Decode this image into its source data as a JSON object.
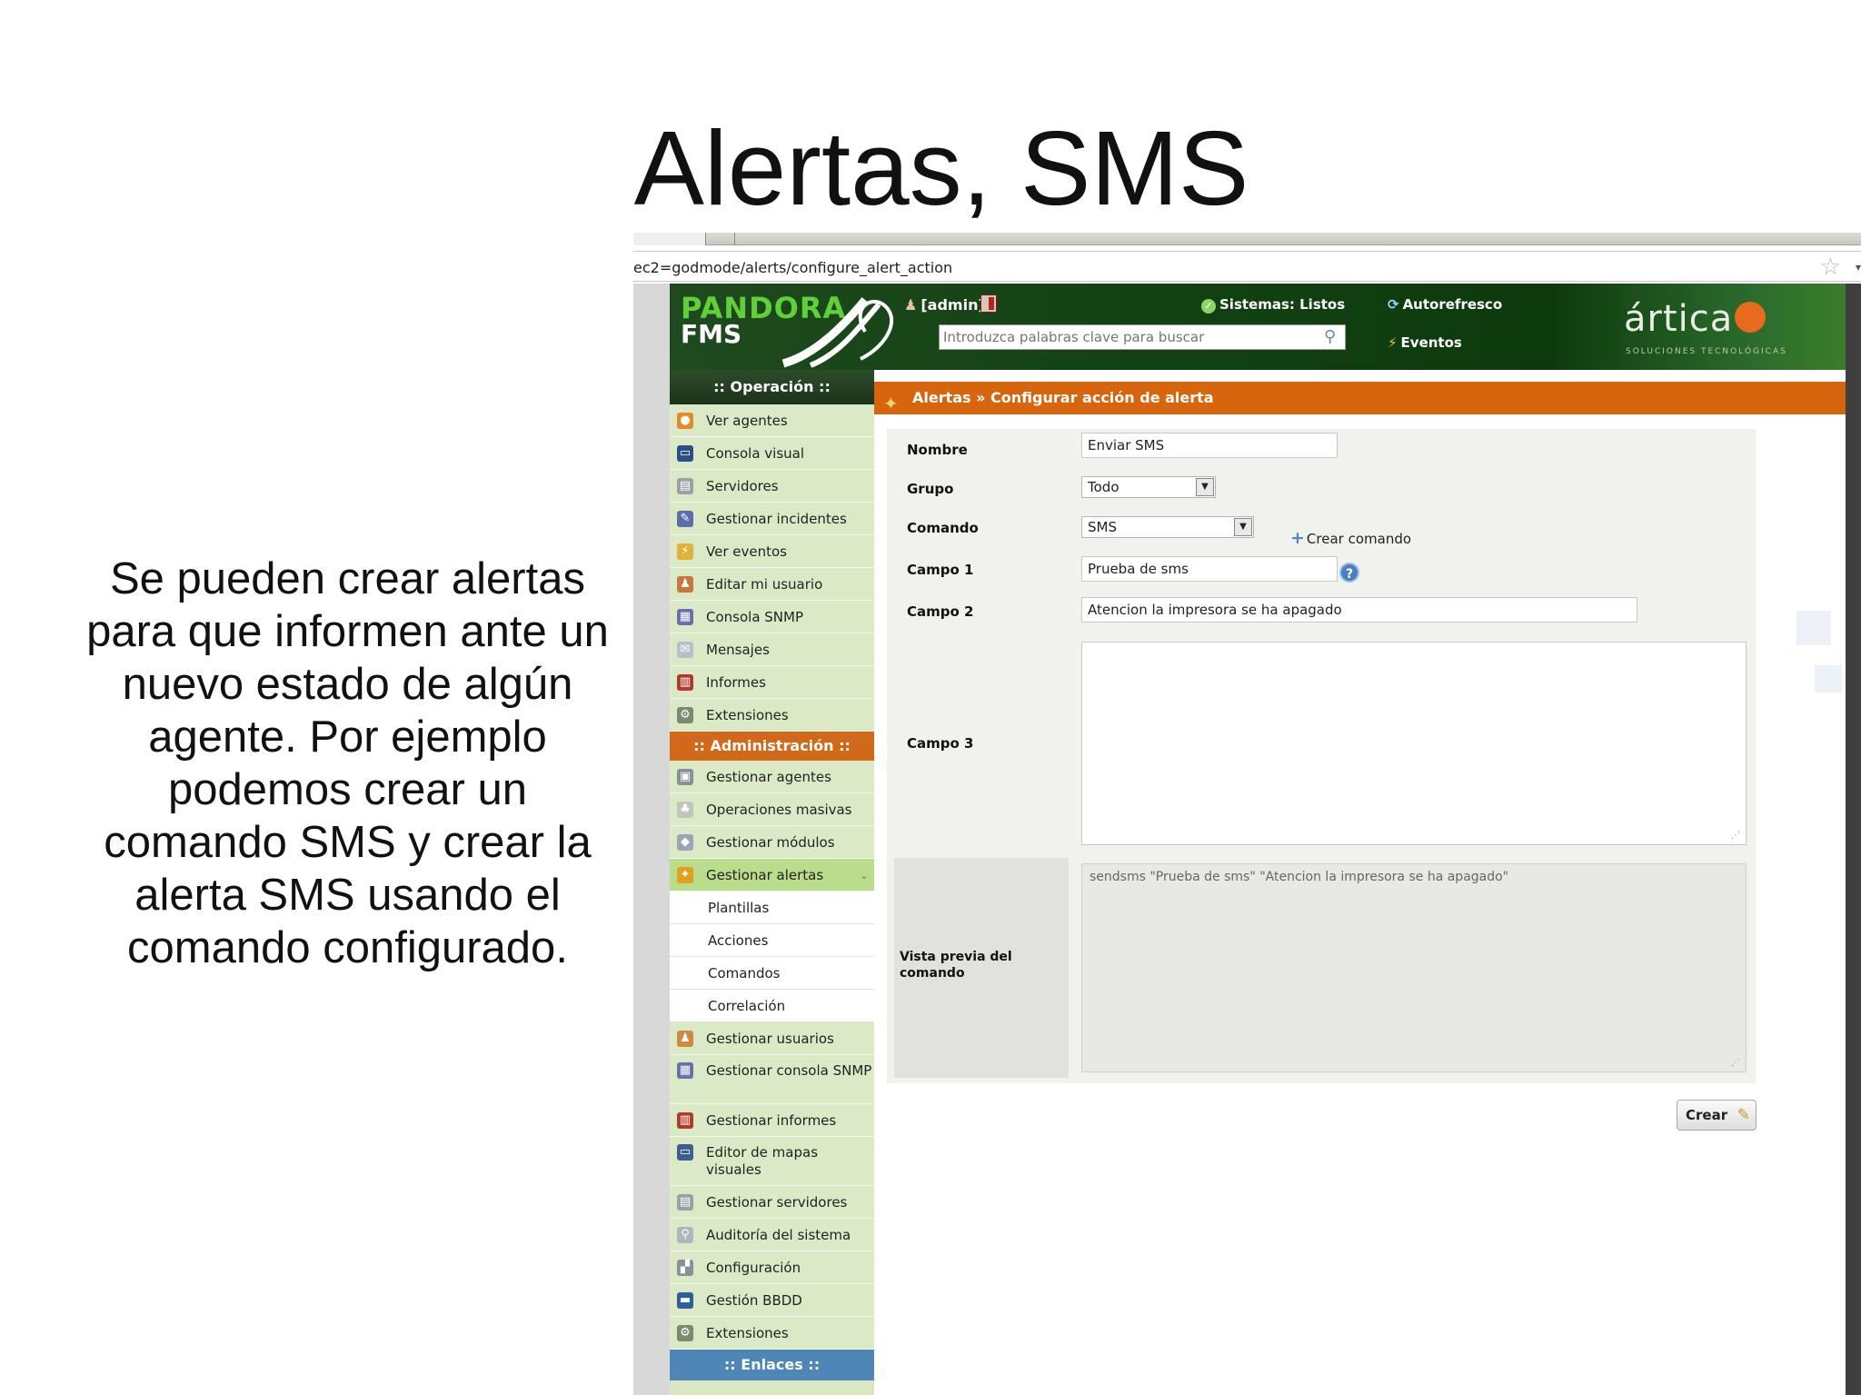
{
  "slide": {
    "title": "Alertas, SMS",
    "body": "Se pueden crear alertas para que informen ante un nuevo estado de algún agente. Por ejemplo podemos crear un comando SMS y crear la alerta SMS usando el comando configurado."
  },
  "browser": {
    "url": "ec2=godmode/alerts/configure_alert_action"
  },
  "header": {
    "logo_top": "PANDORA",
    "logo_bottom": "FMS",
    "user": "[admin]",
    "status": "Sistemas: Listos",
    "search_placeholder": "Introduzca palabras clave para buscar",
    "autorefresh": "Autorefresco",
    "events": "Eventos",
    "brand": "ártica",
    "brand_sub": "SOLUCIONES TECNOLÓGICAS"
  },
  "sidebar": {
    "operation_header": ":: Operación ::",
    "operation_items": [
      "Ver agentes",
      "Consola visual",
      "Servidores",
      "Gestionar incidentes",
      "Ver eventos",
      "Editar mi usuario",
      "Consola SNMP",
      "Mensajes",
      "Informes",
      "Extensiones"
    ],
    "admin_header": ":: Administración ::",
    "admin_items_top": [
      "Gestionar agentes",
      "Operaciones masivas",
      "Gestionar módulos"
    ],
    "active_item": "Gestionar alertas",
    "sub_items": [
      "Plantillas",
      "Acciones",
      "Comandos",
      "Correlación"
    ],
    "admin_items_bottom": [
      "Gestionar usuarios",
      "Gestionar consola SNMP",
      "Gestionar informes",
      "Editor de mapas visuales",
      "Gestionar servidores",
      "Auditoría del sistema",
      "Configuración",
      "Gestión BBDD",
      "Extensiones"
    ],
    "links_header": ":: Enlaces ::"
  },
  "main": {
    "breadcrumb": "Alertas » Configurar acción de alerta",
    "form": {
      "nombre_label": "Nombre",
      "nombre_value": "Enviar SMS",
      "grupo_label": "Grupo",
      "grupo_value": "Todo",
      "comando_label": "Comando",
      "comando_value": "SMS",
      "crear_comando": "Crear comando",
      "campo1_label": "Campo 1",
      "campo1_value": "Prueba de sms",
      "campo2_label": "Campo 2",
      "campo2_value": "Atencion la impresora se ha apagado",
      "campo3_label": "Campo 3",
      "campo3_value": "",
      "preview_label": "Vista previa del comando",
      "preview_value": "sendsms \"Prueba de sms\" \"Atencion la impresora se ha apagado\"",
      "submit": "Crear"
    }
  },
  "colors": {
    "header_green": "#124212",
    "crumb_orange": "#d7650e",
    "admin_orange": "#d2681a",
    "links_blue": "#4f86b8",
    "sidebar_green": "#d9e8c3",
    "active_green": "#b9dd8a"
  }
}
